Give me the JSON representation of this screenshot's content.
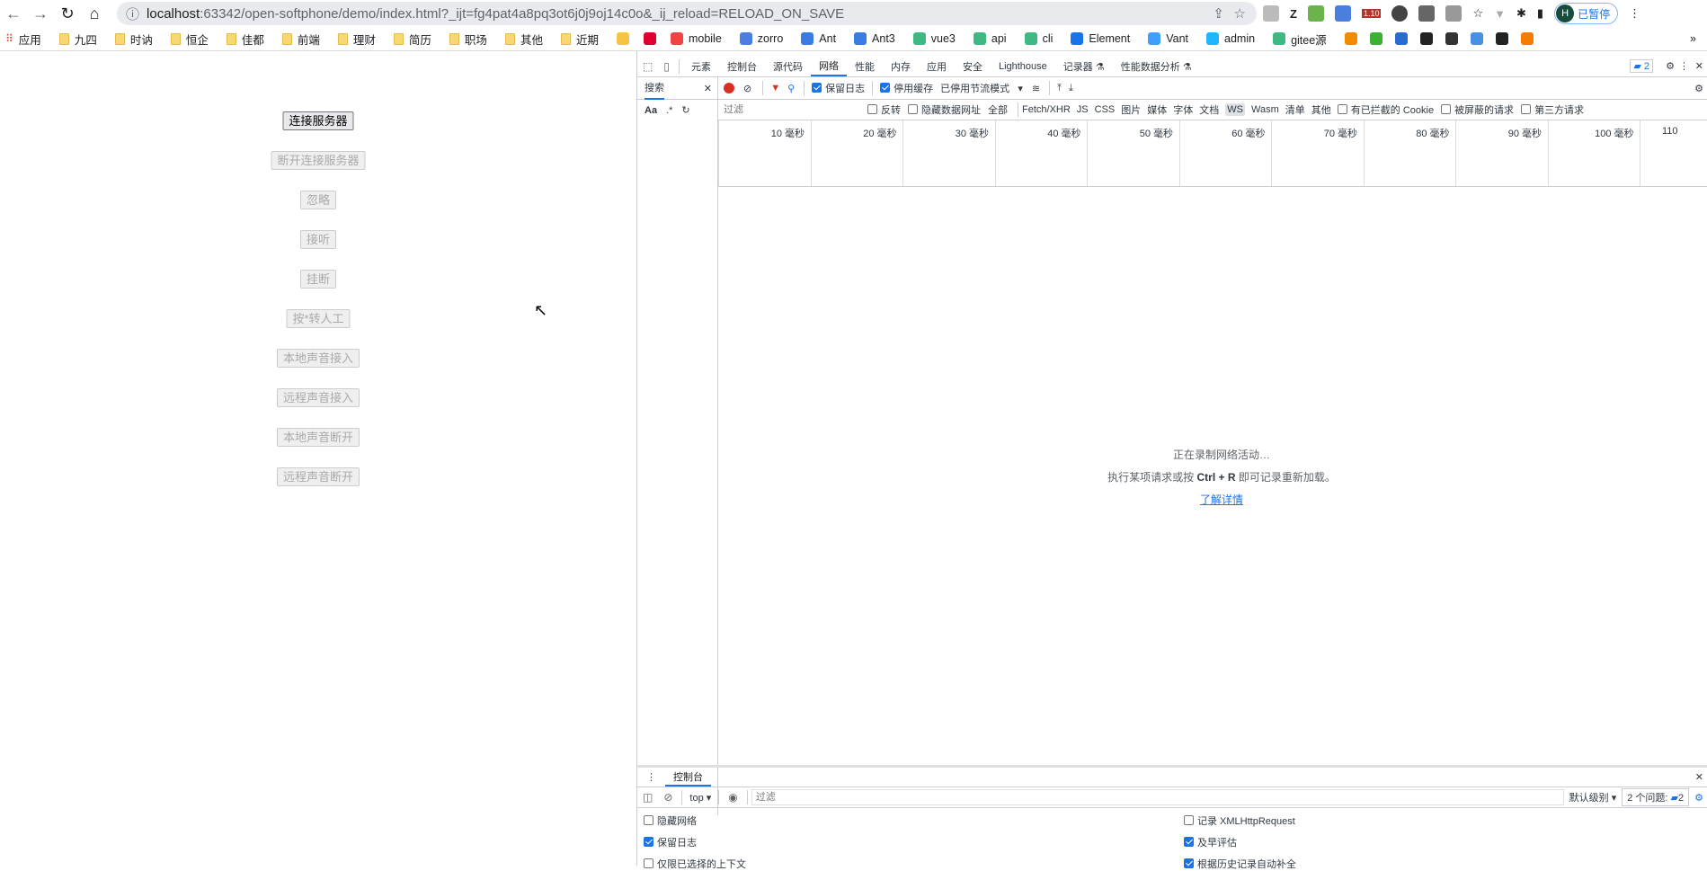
{
  "browser": {
    "url_host": "localhost",
    "url_rest": ":63342/open-softphone/demo/index.html?_ijt=fg4pat4a8pq3ot6j0j9oj14c0o&_ij_reload=RELOAD_ON_SAVE",
    "profile_initial": "H",
    "profile_label": "已暂停",
    "ext_badge": "1.10",
    "bookmarks": [
      "应用",
      "九四",
      "时讷",
      "恒企",
      "佳都",
      "前端",
      "理财",
      "简历",
      "职场",
      "其他",
      "近期"
    ],
    "bookmarks_icons": [
      "mobile",
      "zorro",
      "Ant",
      "Ant3",
      "vue3",
      "api",
      "cli",
      "Element",
      "Vant",
      "admin",
      "gitee源"
    ],
    "more": "»"
  },
  "page": {
    "buttons": [
      "连接服务器",
      "断开连接服务器",
      "忽略",
      "接听",
      "挂断",
      "按*转人工",
      "本地声音接入",
      "远程声音接入",
      "本地声音断开",
      "远程声音断开"
    ]
  },
  "devtools": {
    "tabs": [
      "元素",
      "控制台",
      "源代码",
      "网络",
      "性能",
      "内存",
      "应用",
      "安全",
      "Lighthouse",
      "记录器 ⚗",
      "性能数据分析 ⚗"
    ],
    "issues_count": "2",
    "search_tab": "搜索",
    "preserve_log": "保留日志",
    "disable_cache": "停用缓存",
    "throttle": "已停用节流模式",
    "filter_placeholder": "过滤",
    "invert": "反转",
    "hide_data_urls": "隐藏数据网址",
    "types": [
      "全部",
      "Fetch/XHR",
      "JS",
      "CSS",
      "图片",
      "媒体",
      "字体",
      "文档",
      "WS",
      "Wasm",
      "清单",
      "其他"
    ],
    "blocked_cookies": "有已拦截的 Cookie",
    "blocked_requests": "被屏蔽的请求",
    "third_party": "第三方请求",
    "timeline_ticks": [
      "10 毫秒",
      "20 毫秒",
      "30 毫秒",
      "40 毫秒",
      "50 毫秒",
      "60 毫秒",
      "70 毫秒",
      "80 毫秒",
      "90 毫秒",
      "100 毫秒",
      "110"
    ],
    "empty_line1": "正在录制网络活动…",
    "empty_line2_a": "执行某项请求或按 ",
    "empty_line2_key": "Ctrl + R",
    "empty_line2_b": " 即可记录重新加载。",
    "learn_more": "了解详情",
    "drawer": {
      "tab": "控制台",
      "context": "top",
      "filter_placeholder": "过滤",
      "level": "默认级别",
      "issues": "2 个问题:",
      "issues_count": "2",
      "options_left": [
        {
          "label": "隐藏网络",
          "checked": false
        },
        {
          "label": "保留日志",
          "checked": true
        },
        {
          "label": "仅限已选择的上下文",
          "checked": false
        }
      ],
      "options_right": [
        {
          "label": "记录 XMLHttpRequest",
          "checked": false
        },
        {
          "label": "及早评估",
          "checked": true
        },
        {
          "label": "根据历史记录自动补全",
          "checked": true
        }
      ]
    }
  }
}
